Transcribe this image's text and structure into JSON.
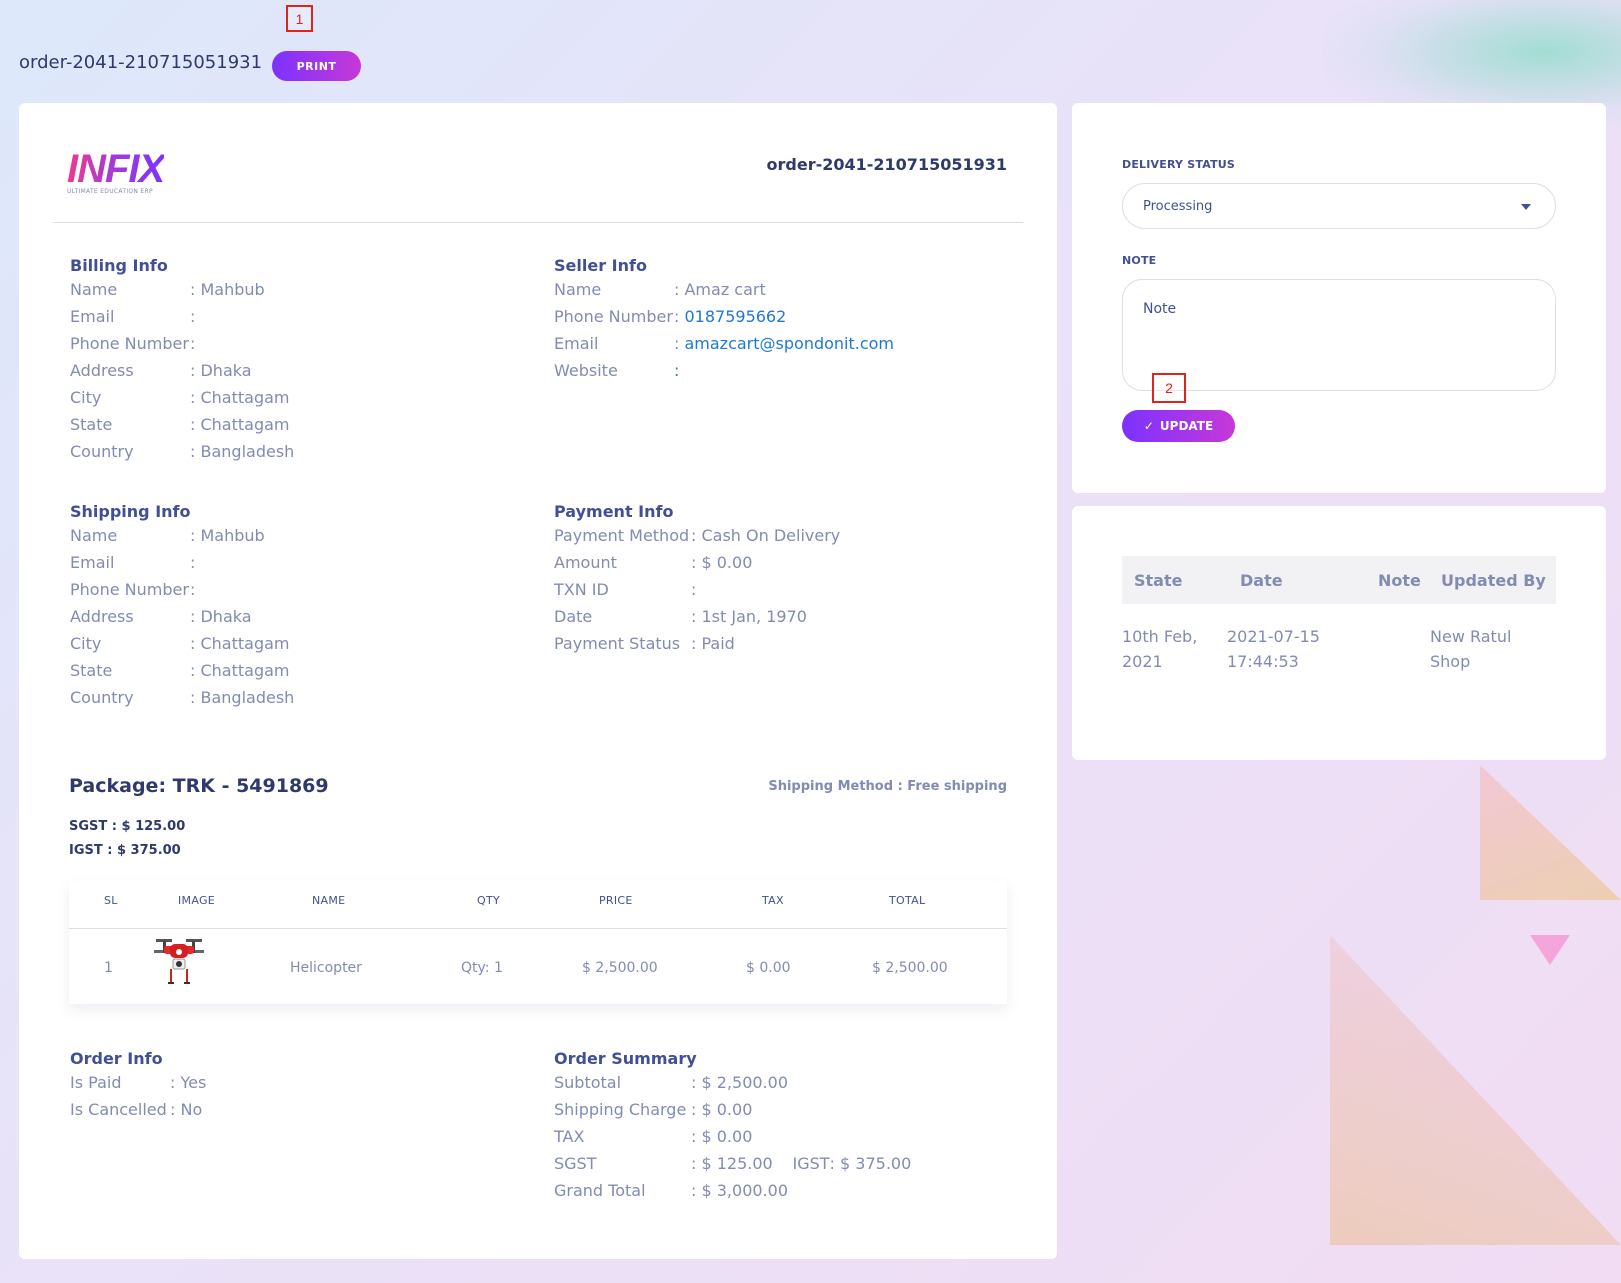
{
  "page": {
    "order_id": "order-2041-210715051931",
    "print_label": "PRINT"
  },
  "markers": [
    "1",
    "2"
  ],
  "invoice": {
    "logo_text": "INFIX",
    "logo_subtitle": "ULTIMATE EDUCATION ERP",
    "order_id": "order-2041-210715051931",
    "billing": {
      "title": "Billing Info",
      "rows": [
        {
          "k": "Name",
          "v": "Mahbub"
        },
        {
          "k": "Email",
          "v": ""
        },
        {
          "k": "Phone Number",
          "v": ""
        },
        {
          "k": "Address",
          "v": "Dhaka"
        },
        {
          "k": "City",
          "v": "Chattagam"
        },
        {
          "k": "State",
          "v": "Chattagam"
        },
        {
          "k": "Country",
          "v": "Bangladesh"
        }
      ]
    },
    "seller": {
      "title": "Seller Info",
      "rows": [
        {
          "k": "Name",
          "v": "Amaz cart"
        },
        {
          "k": "Phone Number",
          "v": "0187595662"
        },
        {
          "k": "Email",
          "v": "amazcart@spondonit.com"
        },
        {
          "k": "Website",
          "v": ""
        }
      ]
    },
    "shipping": {
      "title": "Shipping Info",
      "rows": [
        {
          "k": "Name",
          "v": "Mahbub"
        },
        {
          "k": "Email",
          "v": ""
        },
        {
          "k": "Phone Number",
          "v": ""
        },
        {
          "k": "Address",
          "v": "Dhaka"
        },
        {
          "k": "City",
          "v": "Chattagam"
        },
        {
          "k": "State",
          "v": "Chattagam"
        },
        {
          "k": "Country",
          "v": "Bangladesh"
        }
      ]
    },
    "payment": {
      "title": "Payment Info",
      "rows": [
        {
          "k": "Payment Method",
          "v": "Cash On Delivery"
        },
        {
          "k": "Amount",
          "v": "$ 0.00"
        },
        {
          "k": "TXN ID",
          "v": ""
        },
        {
          "k": "Date",
          "v": "1st Jan, 1970"
        },
        {
          "k": "Payment Status",
          "v": "Paid"
        }
      ]
    },
    "package": {
      "title": "Package: TRK - 5491869",
      "shipping_method": "Shipping Method : Free shipping",
      "sgst": "SGST : $ 125.00",
      "igst": "IGST : $ 375.00"
    },
    "table": {
      "headers": [
        "SL",
        "IMAGE",
        "NAME",
        "QTY",
        "PRICE",
        "TAX",
        "TOTAL"
      ],
      "rows": [
        {
          "sl": "1",
          "image": "drone-image",
          "name": "Helicopter",
          "qty": "Qty: 1",
          "price": "$ 2,500.00",
          "tax": "$ 0.00",
          "total": "$ 2,500.00"
        }
      ]
    },
    "order_info": {
      "title": "Order Info",
      "rows": [
        {
          "k": "Is Paid",
          "v": "Yes"
        },
        {
          "k": "Is Cancelled",
          "v": "No"
        }
      ]
    },
    "order_summary": {
      "title": "Order Summary",
      "rows": [
        {
          "k": "Subtotal",
          "v": "$ 2,500.00"
        },
        {
          "k": "Shipping Charge",
          "v": "$ 0.00"
        },
        {
          "k": "TAX",
          "v": "$ 0.00"
        },
        {
          "k": "SGST",
          "v": "$ 125.00",
          "extra_k": "IGST",
          "extra_v": "$ 375.00"
        },
        {
          "k": "Grand Total",
          "v": "$ 3,000.00"
        }
      ]
    }
  },
  "status_panel": {
    "delivery_status_label": "DELIVERY STATUS",
    "delivery_status_value": "Processing",
    "note_label": "NOTE",
    "note_placeholder": "Note",
    "update_label": "UPDATE"
  },
  "history": {
    "headers": [
      "State",
      "Date",
      "Note",
      "Updated By"
    ],
    "rows": [
      {
        "state": "10th Feb, 2021",
        "date": "2021-07-15 17:44:53",
        "note": "",
        "updated_by": "New Ratul Shop"
      }
    ]
  },
  "colors": {
    "accent_start": "#7c32ff",
    "accent_end": "#c738d8",
    "text": "#415094",
    "muted": "#828bb2",
    "link": "#1e78d8"
  }
}
